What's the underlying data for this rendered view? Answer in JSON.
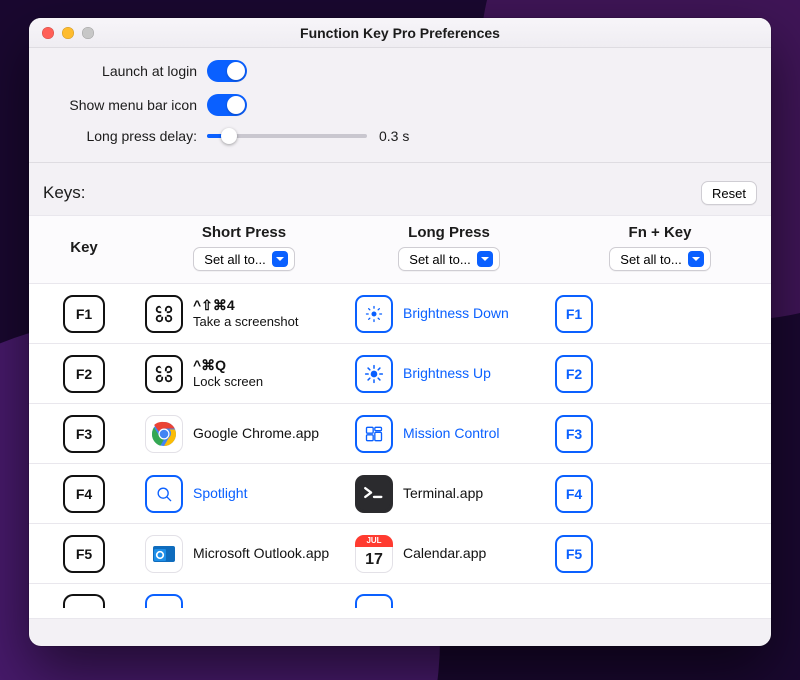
{
  "window": {
    "title": "Function Key Pro Preferences"
  },
  "settings": {
    "launch_at_login": {
      "label": "Launch at login",
      "value": true
    },
    "menu_bar_icon": {
      "label": "Show menu bar icon",
      "value": true
    },
    "long_press_delay": {
      "label": "Long press delay:",
      "value_text": "0.3 s",
      "value_frac": 0.14
    }
  },
  "keys_section": {
    "label": "Keys:",
    "reset": "Reset",
    "columns": {
      "key": "Key",
      "short": "Short Press",
      "long": "Long Press",
      "fn": "Fn + Key"
    },
    "set_all": "Set all to..."
  },
  "rows": [
    {
      "key": "F1",
      "short": {
        "type": "shortcut",
        "combo": "^⇧⌘4",
        "desc": "Take a screenshot"
      },
      "long": {
        "type": "system",
        "icon": "brightness-down",
        "label": "Brightness Down"
      },
      "fn": {
        "type": "fnkey",
        "label": "F1"
      }
    },
    {
      "key": "F2",
      "short": {
        "type": "shortcut",
        "combo": "^⌘Q",
        "desc": "Lock screen"
      },
      "long": {
        "type": "system",
        "icon": "brightness-up",
        "label": "Brightness Up"
      },
      "fn": {
        "type": "fnkey",
        "label": "F2"
      }
    },
    {
      "key": "F3",
      "short": {
        "type": "app",
        "icon": "chrome",
        "label": "Google Chrome.app"
      },
      "long": {
        "type": "system",
        "icon": "mission-control",
        "label": "Mission Control"
      },
      "fn": {
        "type": "fnkey",
        "label": "F3"
      }
    },
    {
      "key": "F4",
      "short": {
        "type": "system",
        "icon": "spotlight",
        "label": "Spotlight"
      },
      "long": {
        "type": "app",
        "icon": "terminal",
        "label": "Terminal.app"
      },
      "fn": {
        "type": "fnkey",
        "label": "F4"
      }
    },
    {
      "key": "F5",
      "short": {
        "type": "app",
        "icon": "outlook",
        "label": "Microsoft Outlook.app"
      },
      "long": {
        "type": "app",
        "icon": "calendar",
        "label": "Calendar.app",
        "calendar_day": "17",
        "calendar_bar": "JUL"
      },
      "fn": {
        "type": "fnkey",
        "label": "F5"
      }
    }
  ]
}
